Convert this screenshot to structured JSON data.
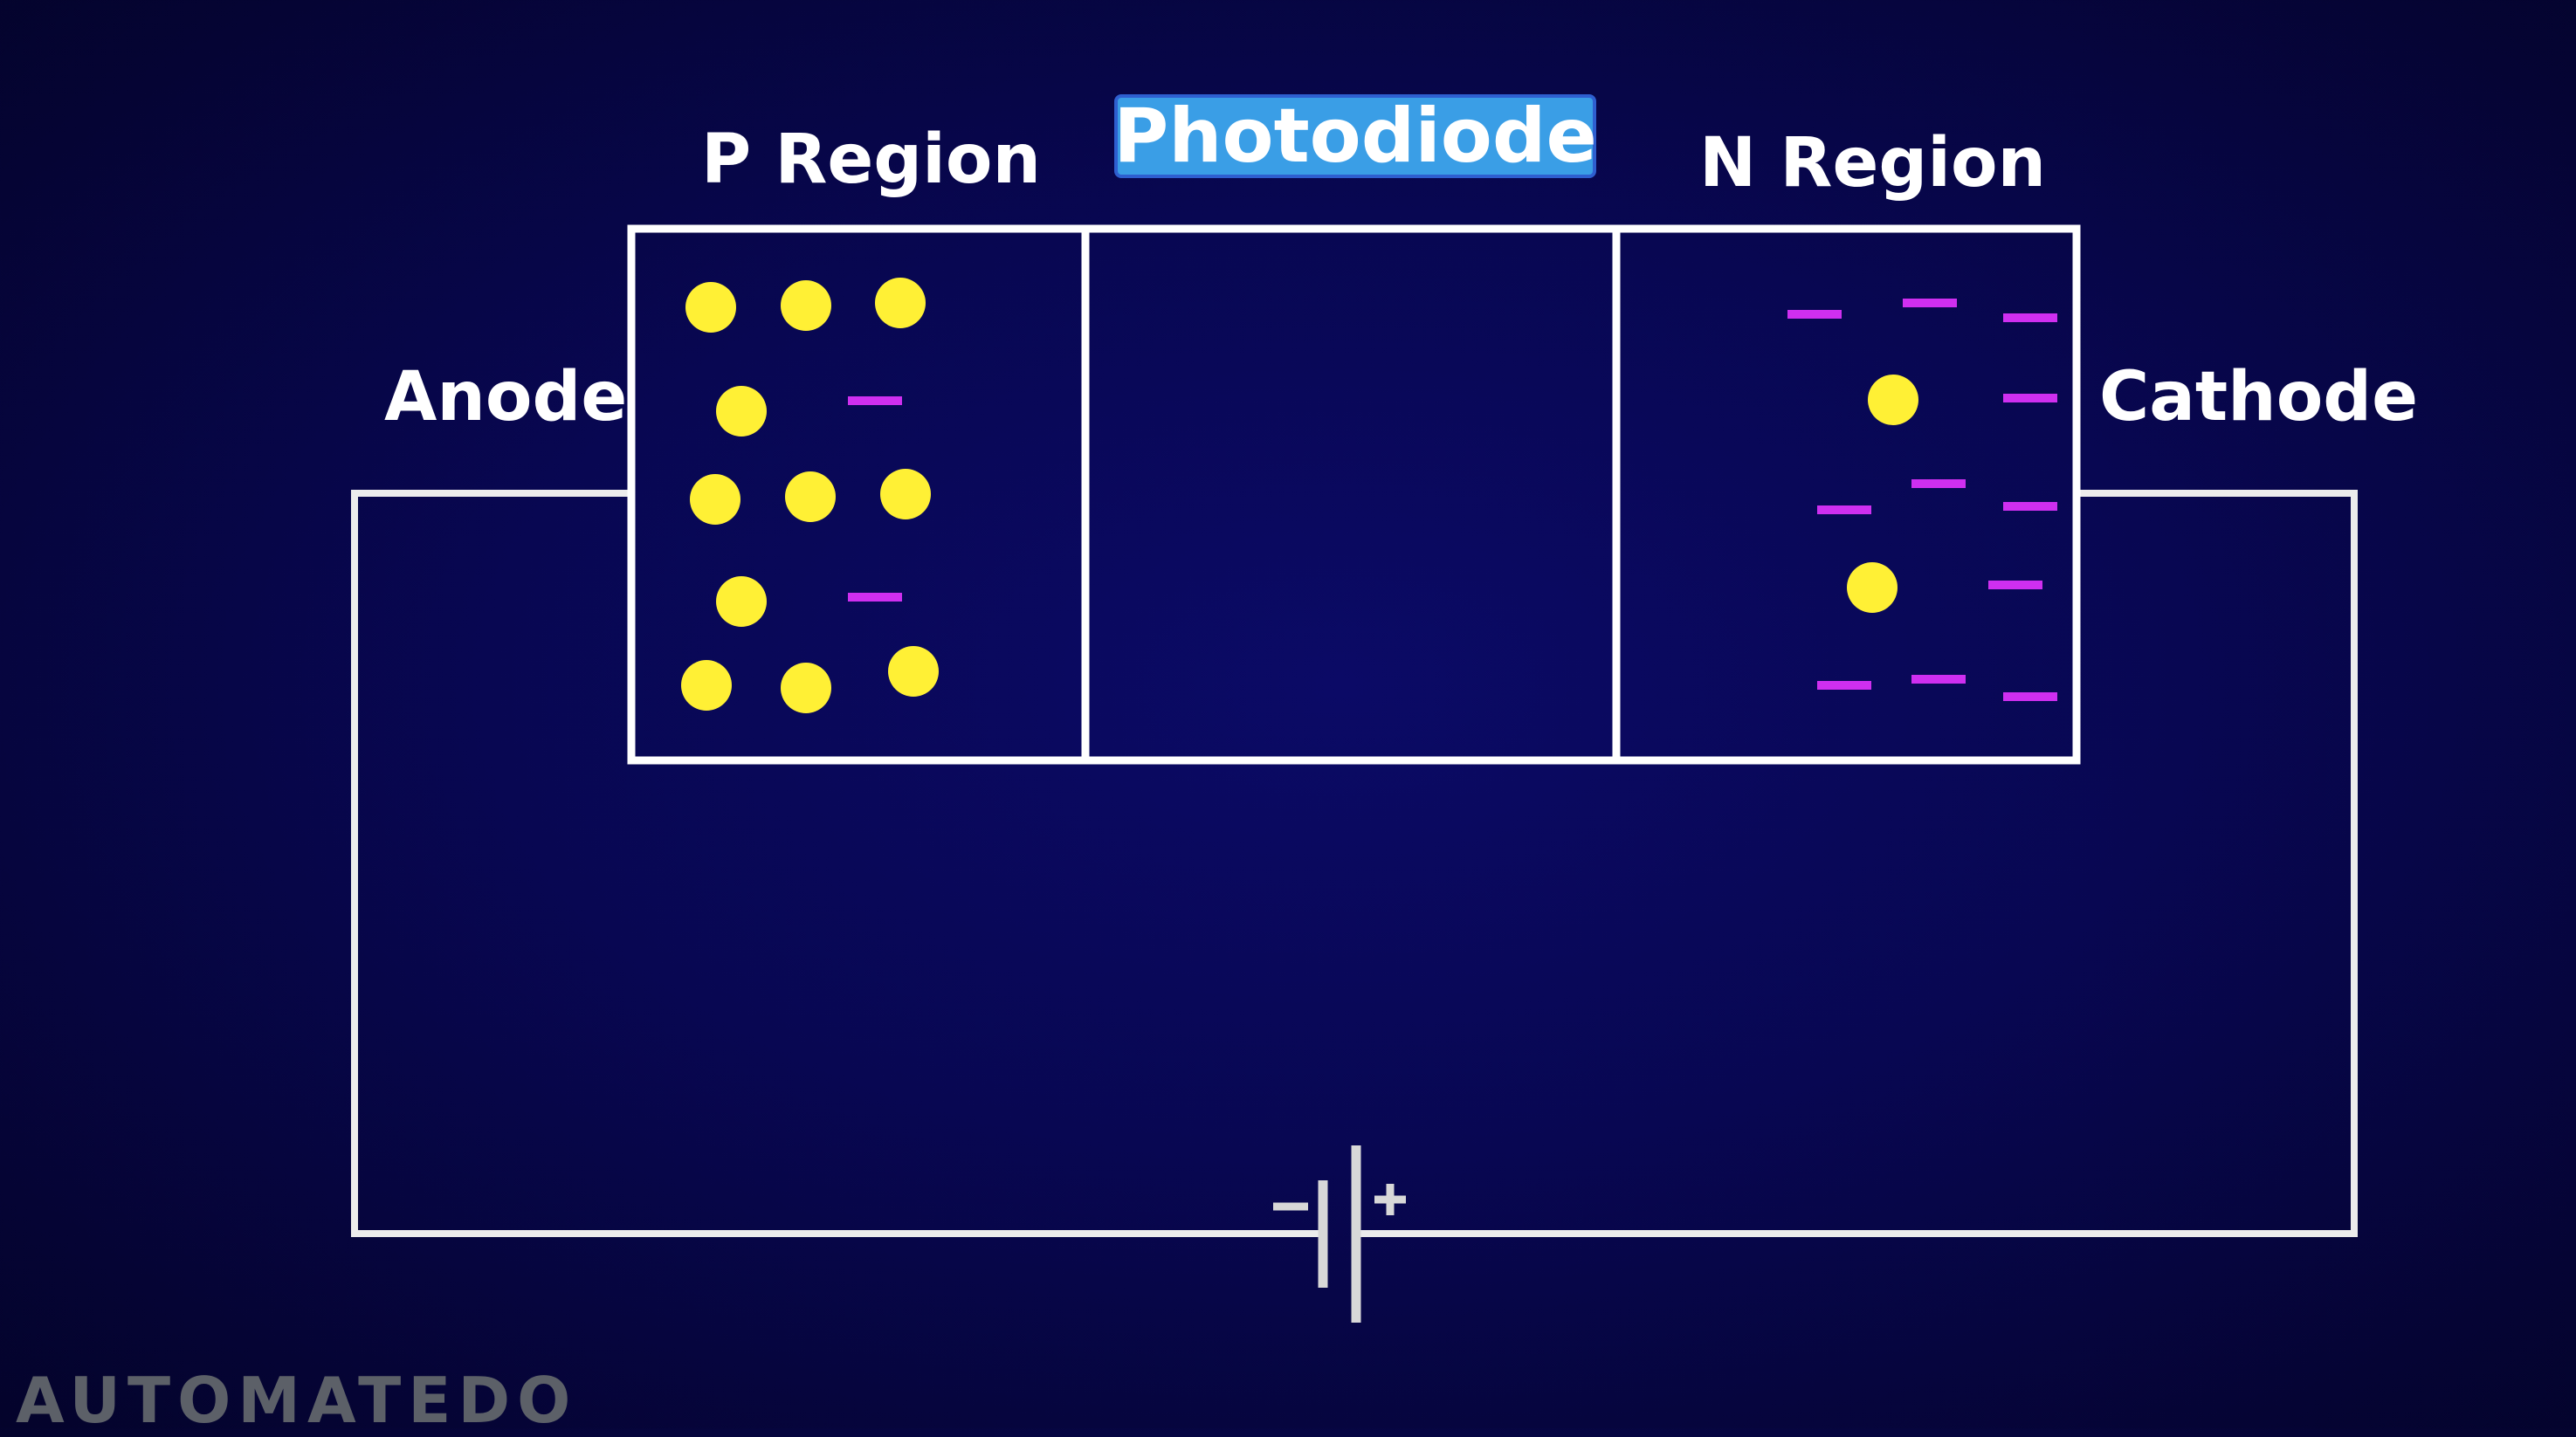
{
  "title": "Photodiode",
  "labels": {
    "p_region": "P Region",
    "n_region": "N Region",
    "anode": "Anode",
    "cathode": "Cathode"
  },
  "battery": {
    "minus": "−",
    "plus": "+"
  },
  "logo": "AUTOMATEDO",
  "colors": {
    "hole": "#fff035",
    "electron": "#cf2ff0",
    "wire": "#f2f2f2",
    "title_bg": "#3a9ee6"
  },
  "counts": {
    "p_region_holes": 12,
    "p_region_electrons": 2,
    "n_region_holes": 2,
    "n_region_electrons": 12
  }
}
